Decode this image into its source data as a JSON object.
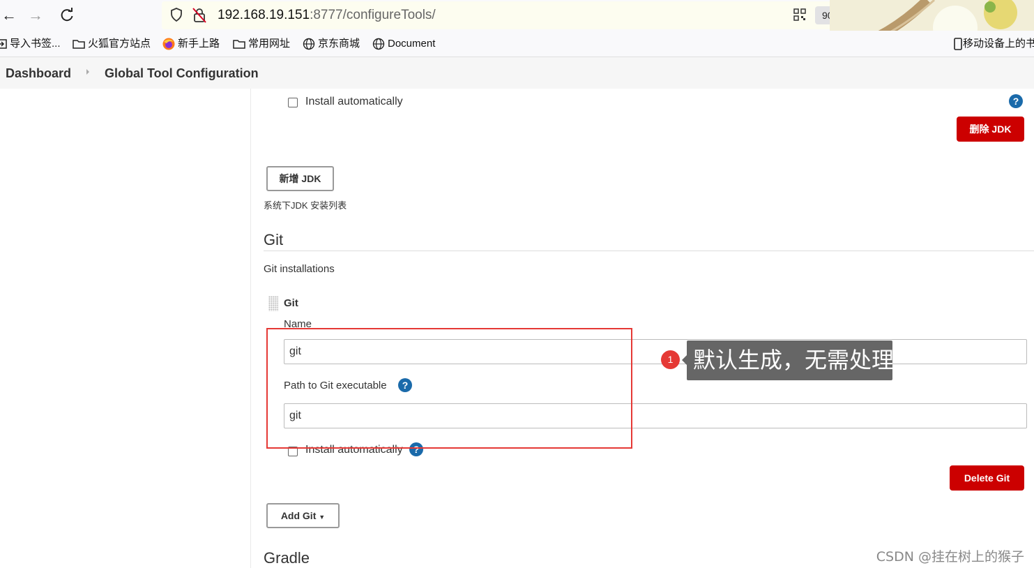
{
  "browser": {
    "url_host": "192.168.19.151",
    "url_rest": ":8777/configureTools/",
    "zoom": "90%"
  },
  "bookmarks": [
    {
      "label": "导入书签...",
      "icon": "import-icon"
    },
    {
      "label": "火狐官方站点",
      "icon": "folder-icon"
    },
    {
      "label": "新手上路",
      "icon": "firefox-icon"
    },
    {
      "label": "常用网址",
      "icon": "folder-icon"
    },
    {
      "label": "京东商城",
      "icon": "globe-icon"
    },
    {
      "label": "Document",
      "icon": "globe-icon"
    },
    {
      "label": "移动设备上的书",
      "icon": "mobile-icon"
    }
  ],
  "breadcrumb": {
    "dashboard": "Dashboard",
    "current": "Global Tool Configuration"
  },
  "jdk": {
    "install_auto_label": "Install automatically",
    "delete_button": "删除 JDK",
    "add_button": "新增 JDK",
    "list_desc": "系统下JDK 安装列表"
  },
  "git": {
    "section_title": "Git",
    "installations_label": "Git installations",
    "item_title": "Git",
    "name_label": "Name",
    "name_value": "git",
    "path_label": "Path to Git executable",
    "path_value": "git",
    "install_auto_label": "Install automatically",
    "delete_button": "Delete Git",
    "add_button": "Add Git"
  },
  "gradle": {
    "section_title": "Gradle"
  },
  "annotation": {
    "number": "1",
    "text": "默认生成，无需处理",
    "color": "#e53935"
  },
  "watermark": "CSDN @挂在树上的猴子"
}
